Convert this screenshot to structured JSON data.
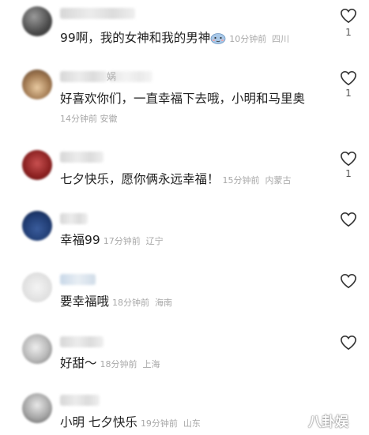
{
  "comments": [
    {
      "text": "99啊，我的女神和我的男神",
      "time": "10分钟前",
      "location": "四川",
      "likes": "1",
      "name_suffix": ""
    },
    {
      "text": "好喜欢你们，一直幸福下去哦，小明和马里奥",
      "time": "14分钟前",
      "location": "安徽",
      "likes": "1",
      "name_suffix": "娲"
    },
    {
      "text": "七夕快乐，愿你俩永远幸福！",
      "time": "15分钟前",
      "location": "内蒙古",
      "likes": "1",
      "name_suffix": ""
    },
    {
      "text": "幸福99",
      "time": "17分钟前",
      "location": "辽宁",
      "likes": "",
      "name_suffix": ""
    },
    {
      "text": "要幸福哦",
      "time": "18分钟前",
      "location": "海南",
      "likes": "",
      "name_suffix": ""
    },
    {
      "text": "好甜～",
      "time": "18分钟前",
      "location": "上海",
      "likes": "",
      "name_suffix": ""
    },
    {
      "text": "小明 七夕快乐",
      "time": "19分钟前",
      "location": "山东",
      "likes": "",
      "name_suffix": ""
    }
  ],
  "watermark": "八卦娱",
  "icons": {
    "like": "heart-outline-icon",
    "emoji": "bashful-face-emoji-icon"
  },
  "colors": {
    "text": "#1f1f1f",
    "meta": "#a8a8a8",
    "background": "#ffffff"
  }
}
